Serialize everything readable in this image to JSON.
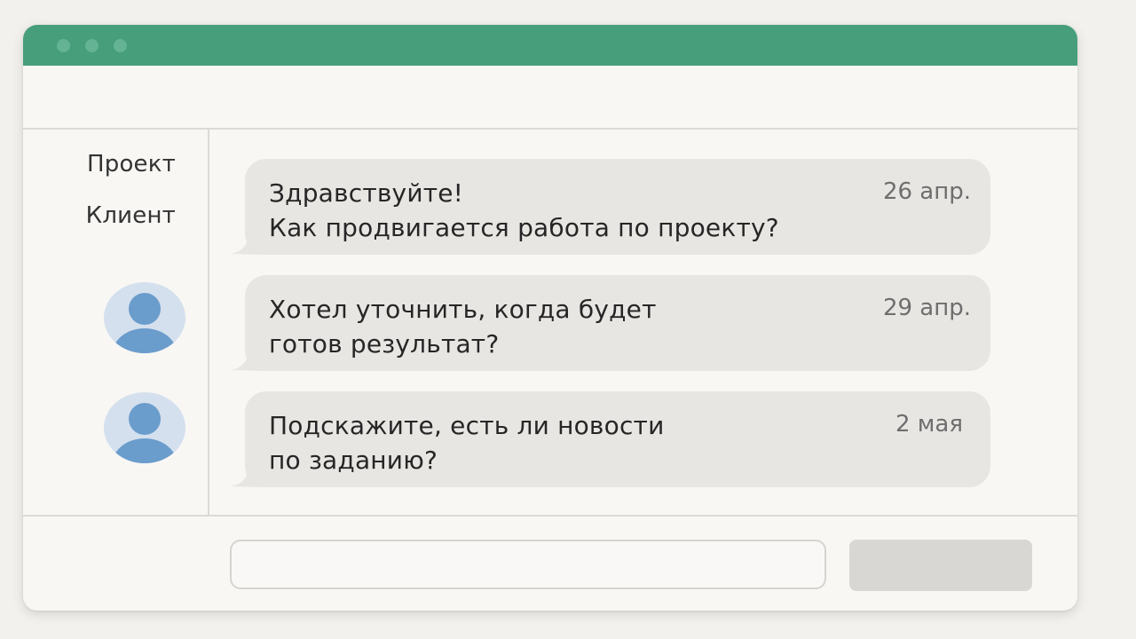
{
  "window": {
    "accent_color": "#479e7b"
  },
  "sidebar": {
    "items": [
      {
        "label": "Проект"
      },
      {
        "label": "Клиент"
      }
    ]
  },
  "messages": [
    {
      "line1": "Здравствуйте!",
      "line2": "Как продвигается работа по проекту?",
      "date": "26 апр."
    },
    {
      "line1": "Хотел уточнить, когда будет",
      "line2": "готов результат?",
      "date": "29 апр."
    },
    {
      "line1": "Подскажите, есть ли новости",
      "line2": "по заданию?",
      "date": "2 мая"
    }
  ],
  "composer": {
    "input_value": "",
    "input_placeholder": "",
    "send_label": ""
  },
  "icons": {
    "avatar": "user-avatar-icon",
    "window_controls": "window-control-dot"
  }
}
